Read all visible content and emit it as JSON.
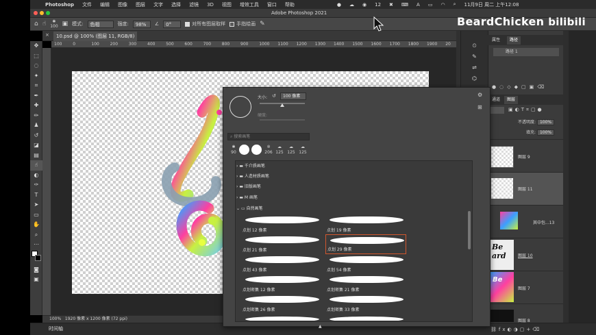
{
  "menubar": {
    "app": "Photoshop",
    "menus": [
      "文件",
      "编辑",
      "图像",
      "图层",
      "文字",
      "选择",
      "滤镜",
      "3D",
      "视图",
      "增效工具",
      "窗口",
      "帮助"
    ],
    "badge_count": "12",
    "datetime": "11月9日 周二 上午12:08"
  },
  "window": {
    "title": "Adobe Photoshop 2021"
  },
  "options_bar": {
    "brush_size": "100",
    "mode_label": "模式:",
    "mode_value": "色相",
    "opacity_label": "强度:",
    "opacity_value": "98%",
    "angle_value": "0°",
    "sample_all_label": "对所有图层取样",
    "finger_paint_label": "手指绘画"
  },
  "document": {
    "tab_label": "10.psd @ 100% (图层 11, RGB/8) *",
    "ruler_ticks": [
      "100",
      "0",
      "100",
      "200",
      "300",
      "400",
      "500",
      "600",
      "700",
      "800",
      "900",
      "1000",
      "1100",
      "1200",
      "1300",
      "1400",
      "1500",
      "1600",
      "1700",
      "1800",
      "1900",
      "20"
    ],
    "zoom": "100%",
    "info": "1920 像素 x 1200 像素 (72 ppi)"
  },
  "timeline": {
    "label": "时间轴"
  },
  "watermark": {
    "text": "BeardChicken",
    "logo": "bilibili"
  },
  "brush_picker": {
    "size_label": "大小:",
    "size_value": "100 像素",
    "hardness_label": "硬度:",
    "search_placeholder": "搜索画笔",
    "recent_sizes": [
      "90",
      "",
      "",
      "206",
      "125",
      "125",
      "125"
    ],
    "folders": [
      "千介质画笔",
      "人造材质画笔",
      "旧版画笔",
      "M 画笔",
      "自然画笔"
    ],
    "brushes": [
      {
        "name": "点划 12 像素",
        "selected": false
      },
      {
        "name": "点划 19 像素",
        "selected": false
      },
      {
        "name": "点划 21 像素",
        "selected": false
      },
      {
        "name": "点划 29 像素",
        "selected": true
      },
      {
        "name": "点划 43 像素",
        "selected": false
      },
      {
        "name": "点划 54 像素",
        "selected": false
      },
      {
        "name": "点划密集 12 像素",
        "selected": false
      },
      {
        "name": "点划密集 21 像素",
        "selected": false
      },
      {
        "name": "点划密集 26 像素",
        "selected": false
      },
      {
        "name": "点划密集 33 像素",
        "selected": false
      }
    ],
    "selection_color": "#d2572e"
  },
  "panels": {
    "properties_tab": "属性",
    "paths_tab": "路径",
    "path_item": "路径 1",
    "channels_tab": "通道",
    "layers_tab": "图层",
    "opacity_label": "不透明度:",
    "opacity_value": "100%",
    "fill_label": "填充:",
    "fill_value": "100%",
    "layers": [
      {
        "name": "图层 9"
      },
      {
        "name": "图层 11",
        "selected": true
      },
      {
        "name": "其中包...13"
      },
      {
        "name": "图层 10"
      },
      {
        "name": "图层 7"
      },
      {
        "name": "图层 8"
      }
    ]
  }
}
